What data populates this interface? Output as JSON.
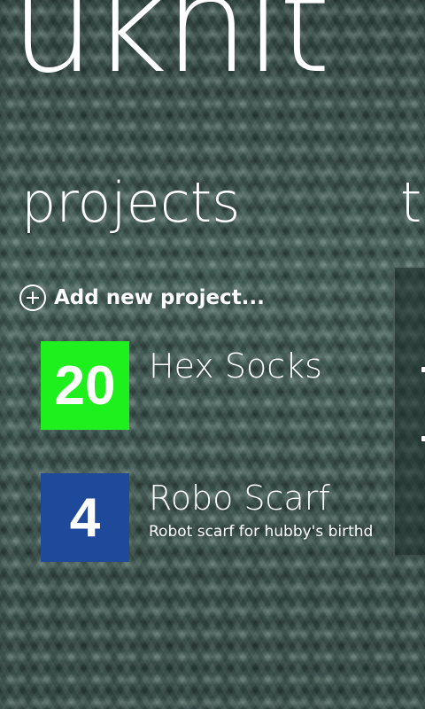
{
  "app": {
    "title": "uknit"
  },
  "pivot": {
    "current": "projects",
    "next_peek": "t"
  },
  "actions": {
    "add_project_label": "Add new project..."
  },
  "projects": [
    {
      "count": "20",
      "name": "Hex Socks",
      "description": "",
      "tile_color": "#1ef01e"
    },
    {
      "count": "4",
      "name": "Robo Scarf",
      "description": "Robot scarf for hubby's birthday",
      "tile_color": "#1f4a9c"
    }
  ],
  "colors": {
    "accent_green": "#1ef01e",
    "accent_blue": "#1f4a9c",
    "text": "#ffffff"
  }
}
